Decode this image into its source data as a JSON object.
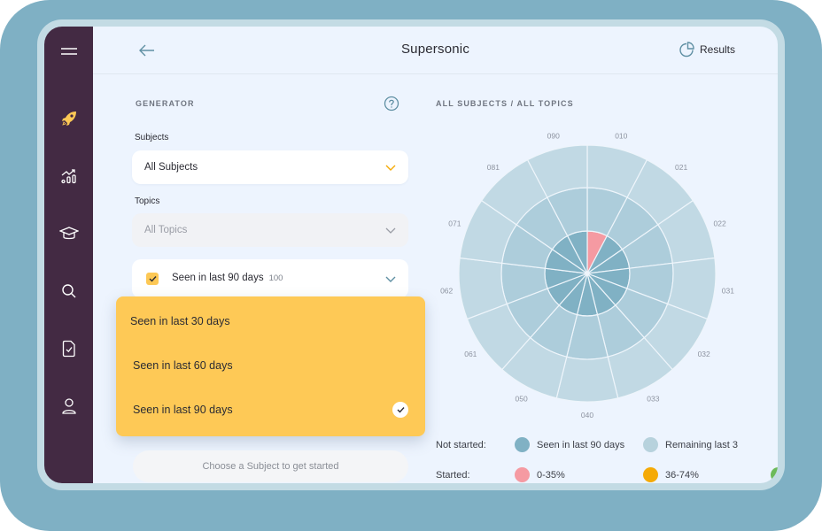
{
  "header": {
    "title": "Supersonic",
    "results_label": "Results"
  },
  "sidebar": {
    "items": [
      {
        "name": "menu",
        "icon": "hamburger-icon"
      },
      {
        "name": "rocket",
        "icon": "rocket-icon",
        "active": true
      },
      {
        "name": "progress",
        "icon": "chart-trend-icon"
      },
      {
        "name": "learn",
        "icon": "graduation-cap-icon"
      },
      {
        "name": "search",
        "icon": "search-icon"
      },
      {
        "name": "tests",
        "icon": "document-check-icon"
      },
      {
        "name": "profile",
        "icon": "user-icon"
      }
    ]
  },
  "generator": {
    "section_label": "GENERATOR",
    "subjects_label": "Subjects",
    "subjects_value": "All Subjects",
    "topics_label": "Topics",
    "topics_value": "All Topics",
    "seen_filter": {
      "label": "Seen in last 90 days",
      "count": "100",
      "checked": true
    },
    "dropdown_options": [
      {
        "label": "Seen in last 30 days",
        "selected": false
      },
      {
        "label": "Seen in last 60 days",
        "selected": false
      },
      {
        "label": "Seen in last 90 days",
        "selected": true
      }
    ],
    "start_button": "Choose a Subject to get started"
  },
  "chart": {
    "section_label": "ALL SUBJECTS / ALL TOPICS"
  },
  "chart_data": {
    "type": "polar-sunburst",
    "title": "ALL SUBJECTS / ALL TOPICS",
    "categories": [
      "010",
      "021",
      "022",
      "031",
      "032",
      "033",
      "040",
      "050",
      "061",
      "062",
      "071",
      "081",
      "090"
    ],
    "rings": [
      "inner",
      "middle",
      "outer"
    ],
    "cells": {
      "inner": [
        "0-35%",
        "seen",
        "seen",
        "seen",
        "seen",
        "seen",
        "seen",
        "seen",
        "seen",
        "seen",
        "seen",
        "seen",
        "seen"
      ],
      "middle": [
        "remaining",
        "remaining",
        "remaining",
        "remaining",
        "remaining",
        "remaining",
        "remaining",
        "remaining",
        "remaining",
        "remaining",
        "remaining",
        "remaining",
        "remaining"
      ],
      "outer": [
        "remaining-outer",
        "remaining-outer",
        "remaining-outer",
        "remaining-outer",
        "remaining-outer",
        "remaining-outer",
        "remaining-outer",
        "remaining-outer",
        "remaining-outer",
        "remaining-outer",
        "remaining-outer",
        "remaining-outer",
        "remaining-outer"
      ]
    },
    "colors": {
      "seen": "#80b1c4",
      "remaining": "#adcddb",
      "remaining-outer": "#c1d9e4",
      "0-35%": "#f59aa2",
      "36-74%": "#f5aa06",
      "75-100%": "#6cba5a"
    }
  },
  "legend": {
    "not_started_label": "Not started:",
    "started_label": "Started:",
    "not_started_items": [
      {
        "label": "Seen in last 90 days",
        "color": "#80b1c4"
      },
      {
        "label": "Remaining last 3",
        "color": "#b7d2dd"
      }
    ],
    "started_items": [
      {
        "label": "0-35%",
        "color": "#f59aa2"
      },
      {
        "label": "36-74%",
        "color": "#f5aa06"
      },
      {
        "label": "",
        "color": "#6cba5a"
      }
    ]
  }
}
